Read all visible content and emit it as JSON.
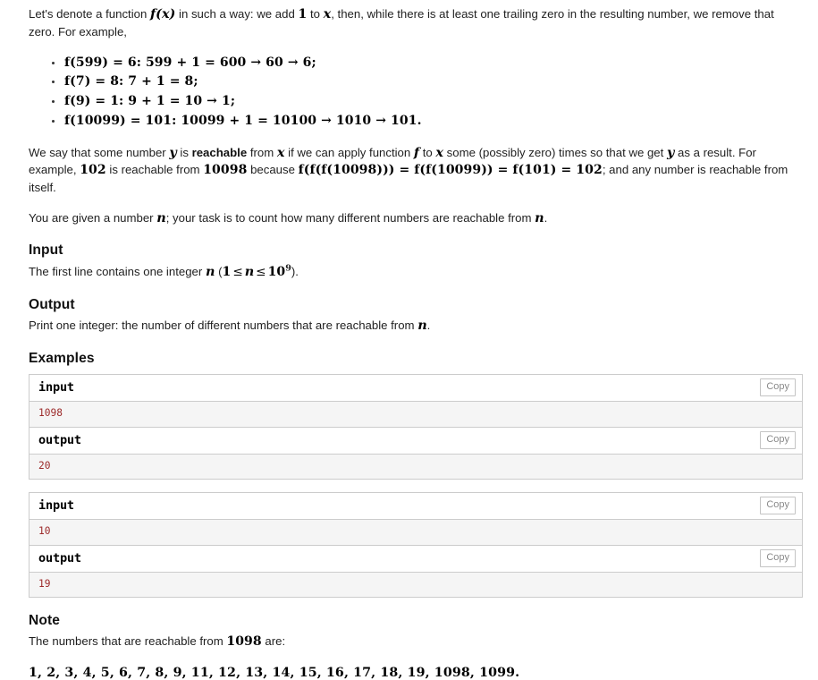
{
  "problem": {
    "intro": {
      "lead_1": "Let's denote a function ",
      "fx": "f(x)",
      "lead_2": " in such a way: we add ",
      "one": "1",
      "lead_3": " to ",
      "x": "x",
      "lead_4": ", then, while there is at least one trailing zero in the resulting number, we remove that zero. For example,"
    },
    "bullets": [
      {
        "math": "f(599) = 6: 599 + 1 = 600 → 60 → 6;"
      },
      {
        "math": "f(7) = 8: 7 + 1 = 8;"
      },
      {
        "math": "f(9) = 1: 9 + 1 = 10 → 1;"
      },
      {
        "math": "f(10099) = 101: 10099 + 1 = 10100 → 1010 → 101."
      }
    ],
    "reachable_para": {
      "t1": "We say that some number ",
      "y": "y",
      "t2": " is ",
      "bold_reachable": "reachable",
      "t3": " from ",
      "x": "x",
      "t4": " if we can apply function ",
      "f": "f",
      "t5": " to ",
      "x2": "x",
      "t6": " some (possibly zero) times so that we get ",
      "y2": "y",
      "t7": " as a result. For example, ",
      "n102": "102",
      "t8": " is reachable from ",
      "n10098": "10098",
      "t9": " because ",
      "chain": "f(f(f(10098))) = f(f(10099)) = f(101) = 102",
      "t10": "; and any number is reachable from itself."
    },
    "task_para": {
      "t1": "You are given a number ",
      "n": "n",
      "t2": "; your task is to count how many different numbers are reachable from ",
      "n2": "n",
      "t3": "."
    },
    "input": {
      "heading": "Input",
      "t1": "The first line contains one integer ",
      "n": "n",
      "t2": " (",
      "range_lo": "1",
      "le1": "≤",
      "range_var": "n",
      "le2": "≤",
      "range_hi_base": "10",
      "range_hi_exp": "9",
      "t3": ")."
    },
    "output": {
      "heading": "Output",
      "text": "Print one integer: the number of different numbers that are reachable from ",
      "n": "n",
      "period": "."
    },
    "examples": {
      "heading": "Examples",
      "copy_label": "Copy",
      "groups": [
        {
          "input_label": "input",
          "input_value": "1098",
          "output_label": "output",
          "output_value": "20"
        },
        {
          "input_label": "input",
          "input_value": "10",
          "output_label": "output",
          "output_value": "19"
        }
      ]
    },
    "note": {
      "heading": "Note",
      "t1": "The numbers that are reachable from ",
      "n1098": "1098",
      "t2": " are:",
      "list": "1, 2, 3, 4, 5, 6, 7, 8, 9, 11, 12, 13, 14, 15, 16, 17, 18, 19, 1098, 1099."
    }
  },
  "colors": {
    "sample_value": "#9c2a2a",
    "sample_body_bg": "#f5f5f5",
    "border": "#cccccc"
  }
}
